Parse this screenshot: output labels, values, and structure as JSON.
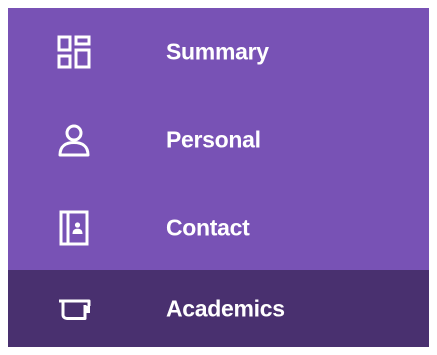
{
  "nav": {
    "items": [
      {
        "label": "Summary",
        "icon": "dashboard-icon",
        "active": false
      },
      {
        "label": "Personal",
        "icon": "person-icon",
        "active": false
      },
      {
        "label": "Contact",
        "icon": "contact-book-icon",
        "active": false
      },
      {
        "label": "Academics",
        "icon": "graduation-cap-icon",
        "active": true
      }
    ]
  },
  "colors": {
    "menu_bg": "#7852b5",
    "active_bg": "#49306f",
    "text": "#ffffff"
  }
}
